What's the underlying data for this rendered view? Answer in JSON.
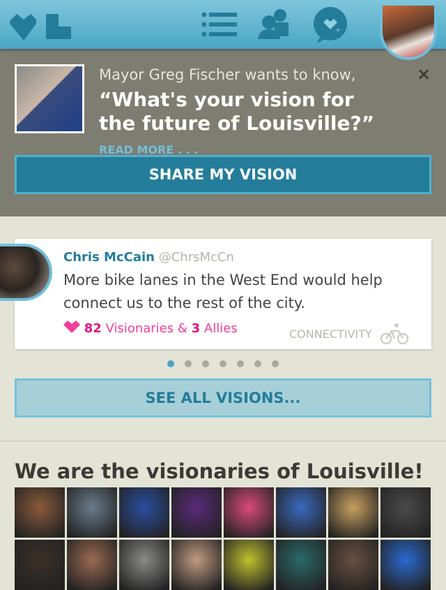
{
  "header": {
    "icons": [
      "logo-icon",
      "list-icon",
      "people-icon",
      "chat-heart-icon"
    ]
  },
  "banner": {
    "intro": "Mayor Greg Fischer wants to know,",
    "question": "“What's your vision for the future of Louisville?”",
    "read_more": "READ MORE . . .",
    "close": "×",
    "share_label": "SHARE MY VISION"
  },
  "vision": {
    "name": "Chris McCain",
    "handle": "@ChrsMcCn",
    "text": "More bike lanes in the West End would help connect us to the rest of the city.",
    "visionaries_count": "82",
    "visionaries_label": "Visionaries",
    "amp": "&",
    "allies_count": "3",
    "allies_label": "Allies",
    "category": "CONNECTIVITY",
    "active_page": 1,
    "total_pages": 7
  },
  "see_all_label": "SEE ALL VISIONS...",
  "visionaries": {
    "heading": "We are the visionaries of Louisville!",
    "tiles": [
      "#8a5a3a",
      "#6a7d8c",
      "#2a4ea0",
      "#5a2a7a",
      "#d94a7a",
      "#3a6ac0",
      "#c8a060",
      "#4a4a4a",
      "#3a3028",
      "#9a6a50",
      "#8a8a88",
      "#c09a80",
      "#c0c030",
      "#2a6a6a",
      "#6a5040",
      "#2a6ad0"
    ]
  },
  "colors": {
    "accent": "#237d9a",
    "pink": "#e0157f"
  }
}
